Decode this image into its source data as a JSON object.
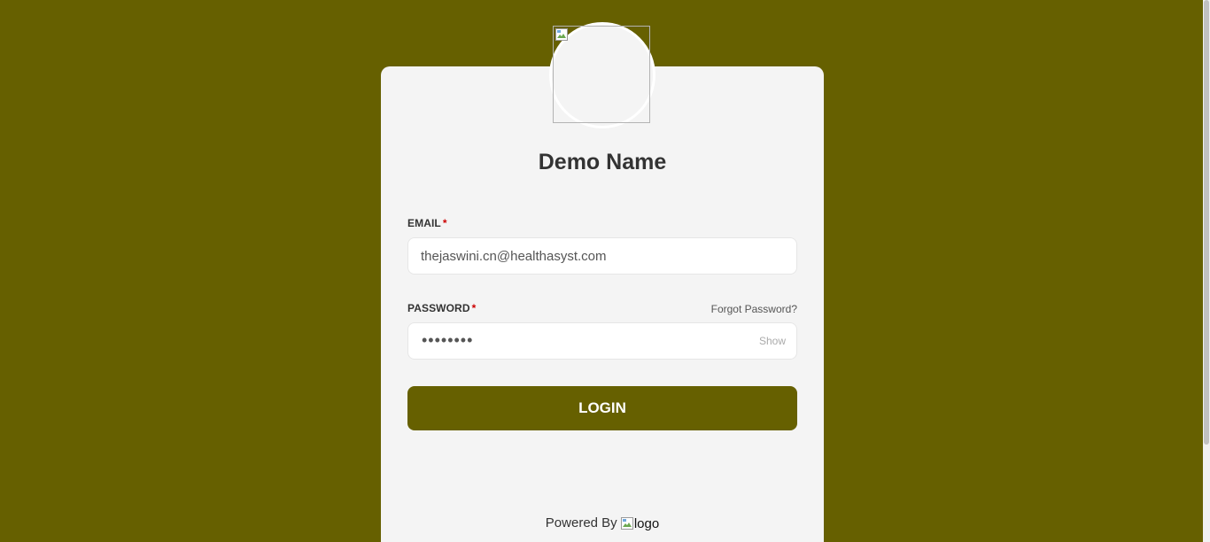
{
  "org": {
    "name": "Demo Name"
  },
  "form": {
    "email_label": "EMAIL",
    "email_required_mark": "*",
    "email_value": "thejaswini.cn@healthasyst.com",
    "password_label": "PASSWORD",
    "password_required_mark": "*",
    "password_masked": "••••••••",
    "show_label": "Show",
    "forgot_label": "Forgot Password?",
    "login_label": "LOGIN"
  },
  "footer": {
    "powered_label": "Powered By",
    "logo_alt": "logo"
  },
  "icons": {
    "avatar": "broken-image-icon",
    "logo": "broken-image-icon"
  },
  "colors": {
    "background": "#666000",
    "card": "#f4f4f4",
    "button": "#666000",
    "required": "#cc0000"
  }
}
